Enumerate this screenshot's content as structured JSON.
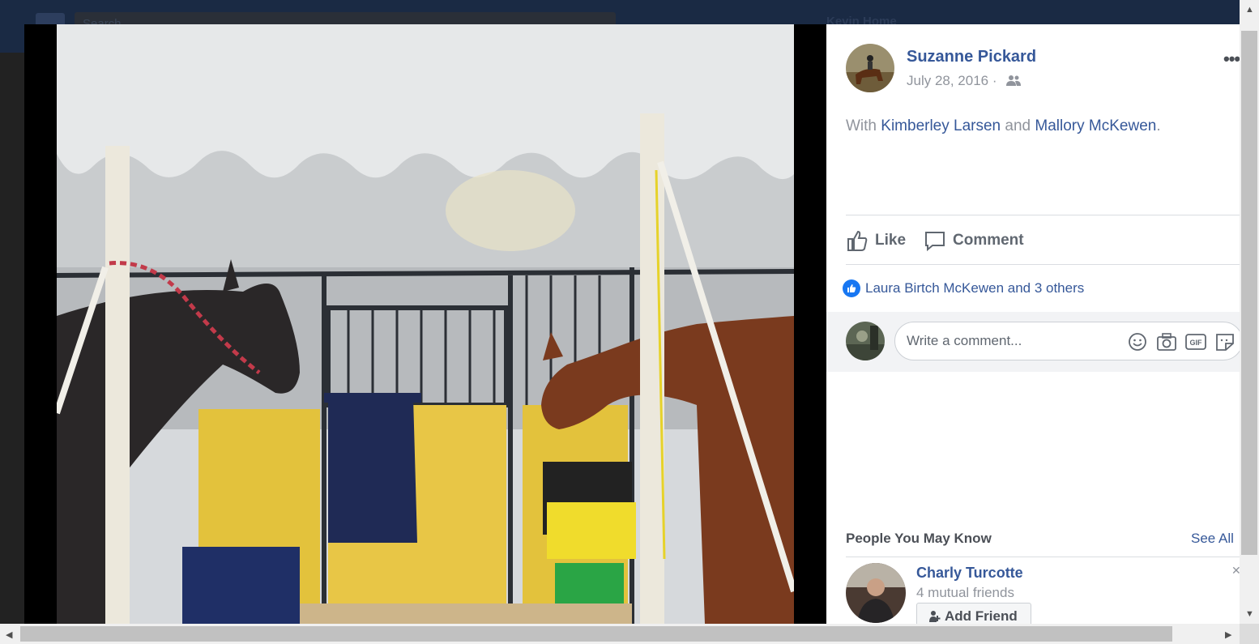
{
  "background": {
    "search_placeholder": "Search",
    "user_nav": "Kevin    Home"
  },
  "post": {
    "author": "Suzanne Pickard",
    "date": "July 28, 2016 ·",
    "audience_icon": "friends-icon",
    "more_label": "•••",
    "with_prefix": "With",
    "tagged_1": "Kimberley Larsen",
    "and": "and",
    "tagged_2": "Mallory McKewen",
    "period": "."
  },
  "actions": {
    "like": "Like",
    "comment": "Comment"
  },
  "reactions": {
    "text": "Laura Birtch McKewen and 3 others"
  },
  "composer": {
    "placeholder": "Write a comment...",
    "icons": [
      "emoji-icon",
      "camera-icon",
      "gif-icon",
      "sticker-icon"
    ]
  },
  "pymk": {
    "title": "People You May Know",
    "see_all": "See All",
    "person": {
      "name": "Charly Turcotte",
      "mutual": "4 mutual friends",
      "button": "Add Friend"
    }
  },
  "colors": {
    "link": "#365899",
    "muted": "#90949c",
    "like_blue": "#1877f2"
  }
}
